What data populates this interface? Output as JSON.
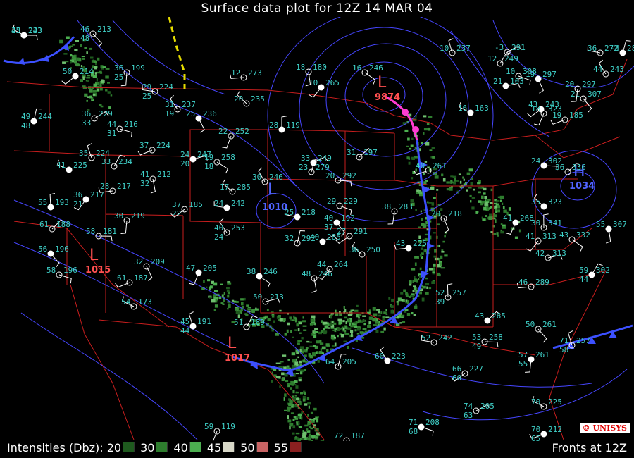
{
  "title": "Surface data plot for 12Z 14 MAR 04",
  "legend": {
    "label": "Intensities (Dbz):",
    "levels": [
      {
        "value": "20",
        "color": "#1e5a1e"
      },
      {
        "value": "30",
        "color": "#2e7d2e"
      },
      {
        "value": "40",
        "color": "#4caf50"
      },
      {
        "value": "45",
        "color": "#d8d8c8"
      },
      {
        "value": "50",
        "color": "#c86464"
      },
      {
        "value": "55",
        "color": "#8a2020"
      }
    ]
  },
  "fronts_label": "Fronts at 12Z",
  "logo": "UNISYS",
  "colors": {
    "isobar": "#4646ff",
    "border": "#c81e1e",
    "station_text": "#3fd0c8",
    "cold_front": "#3c50ff",
    "occluded_front": "#ff3cd2",
    "low": "#ff5050",
    "high": "#5064ff"
  },
  "pressure_centers": [
    {
      "type": "L",
      "value": "9874",
      "color": "#ff5050"
    },
    {
      "type": "L",
      "value": "1010",
      "color": "#5064ff"
    },
    {
      "type": "L",
      "value": "1017",
      "color": "#ff5050"
    },
    {
      "type": "L",
      "value": "1015",
      "color": "#ff5050"
    },
    {
      "type": "H",
      "value": "1034",
      "color": "#5064ff"
    }
  ],
  "stations": [
    {
      "t": "43",
      "d": "",
      "p": "243"
    },
    {
      "t": "46",
      "d": "48",
      "p": "213"
    },
    {
      "t": "36",
      "d": "25",
      "p": "199"
    },
    {
      "t": "50",
      "d": "",
      "p": "214"
    },
    {
      "t": "29",
      "d": "25",
      "p": "224"
    },
    {
      "t": "31",
      "d": "19",
      "p": "237"
    },
    {
      "t": "49",
      "d": "48",
      "p": "244"
    },
    {
      "t": "36",
      "d": "33",
      "p": "229"
    },
    {
      "t": "44",
      "d": "31",
      "p": "216"
    },
    {
      "t": "25",
      "d": "",
      "p": "236"
    },
    {
      "t": "22",
      "d": "",
      "p": "252"
    },
    {
      "t": "37",
      "d": "",
      "p": "224"
    },
    {
      "t": "41",
      "d": "",
      "p": "225"
    },
    {
      "t": "35",
      "d": "",
      "p": "224"
    },
    {
      "t": "33",
      "d": "",
      "p": "234"
    },
    {
      "t": "24",
      "d": "20",
      "p": "247"
    },
    {
      "t": "19",
      "d": "18",
      "p": "258"
    },
    {
      "t": "41",
      "d": "32",
      "p": "212"
    },
    {
      "t": "36",
      "d": "21",
      "p": "217"
    },
    {
      "t": "28",
      "d": "",
      "p": "217"
    },
    {
      "t": "17",
      "d": "",
      "p": "285"
    },
    {
      "t": "55",
      "d": "",
      "p": "193"
    },
    {
      "t": "61",
      "d": "",
      "p": "188"
    },
    {
      "t": "58",
      "d": "",
      "p": "181"
    },
    {
      "t": "56",
      "d": "",
      "p": "196"
    },
    {
      "t": "30",
      "d": "",
      "p": "219"
    },
    {
      "t": "37",
      "d": "22",
      "p": "185"
    },
    {
      "t": "24",
      "d": "",
      "p": "242"
    },
    {
      "t": "40",
      "d": "24",
      "p": "253"
    },
    {
      "t": "32",
      "d": "",
      "p": "292"
    },
    {
      "t": "40",
      "d": "",
      "p": "285"
    },
    {
      "t": "58",
      "d": "",
      "p": "196"
    },
    {
      "t": "32",
      "d": "",
      "p": "209"
    },
    {
      "t": "47",
      "d": "",
      "p": "205"
    },
    {
      "t": "61",
      "d": "",
      "p": "187"
    },
    {
      "t": "54",
      "d": "",
      "p": "173"
    },
    {
      "t": "45",
      "d": "44",
      "p": "191"
    },
    {
      "t": "51",
      "d": "",
      "p": "189"
    },
    {
      "t": "50",
      "d": "",
      "p": "213"
    },
    {
      "t": "38",
      "d": "",
      "p": "246"
    },
    {
      "t": "48",
      "d": "",
      "p": "246"
    },
    {
      "t": "44",
      "d": "",
      "p": "264"
    },
    {
      "t": "43",
      "d": "",
      "p": "225"
    },
    {
      "t": "36",
      "d": "",
      "p": "250"
    },
    {
      "t": "52",
      "d": "39",
      "p": "257"
    },
    {
      "t": "43",
      "d": "",
      "p": "265"
    },
    {
      "t": "53",
      "d": "49",
      "p": "258"
    },
    {
      "t": "50",
      "d": "",
      "p": "261"
    },
    {
      "t": "57",
      "d": "55",
      "p": "261"
    },
    {
      "t": "66",
      "d": "60",
      "p": "227"
    },
    {
      "t": "52",
      "d": "",
      "p": "242"
    },
    {
      "t": "60",
      "d": "",
      "p": "223"
    },
    {
      "t": "64",
      "d": "",
      "p": "205"
    },
    {
      "t": "74",
      "d": "63",
      "p": "205"
    },
    {
      "t": "71",
      "d": "68",
      "p": "208"
    },
    {
      "t": "72",
      "d": "",
      "p": "187"
    },
    {
      "t": "59",
      "d": "",
      "p": "119"
    },
    {
      "t": "70",
      "d": "65",
      "p": "212"
    },
    {
      "t": "70",
      "d": "",
      "p": "225"
    },
    {
      "t": "71",
      "d": "58",
      "p": "257"
    },
    {
      "t": "59",
      "d": "44",
      "p": "302"
    },
    {
      "t": "42",
      "d": "",
      "p": "313"
    },
    {
      "t": "43",
      "d": "",
      "p": "332"
    },
    {
      "t": "55",
      "d": "",
      "p": "307"
    },
    {
      "t": "41",
      "d": "",
      "p": "313"
    },
    {
      "t": "46",
      "d": "",
      "p": "289"
    },
    {
      "t": "35",
      "d": "",
      "p": "323"
    },
    {
      "t": "30",
      "d": "",
      "p": "341"
    },
    {
      "t": "36",
      "d": "",
      "p": "336"
    },
    {
      "t": "24",
      "d": "",
      "p": "302"
    },
    {
      "t": "21",
      "d": "",
      "p": "307"
    },
    {
      "t": "20",
      "d": "",
      "p": "297"
    },
    {
      "t": "43",
      "d": "",
      "p": "243"
    },
    {
      "t": "36",
      "d": "",
      "p": "272"
    },
    {
      "t": "44",
      "d": "",
      "p": "243"
    },
    {
      "t": "-4",
      "d": "",
      "p": "284"
    },
    {
      "t": "-3",
      "d": "",
      "p": "291"
    },
    {
      "t": "10",
      "d": "",
      "p": "308"
    },
    {
      "t": "19",
      "d": "",
      "p": "297"
    },
    {
      "t": "18",
      "d": "",
      "p": "323"
    },
    {
      "t": "19",
      "d": "",
      "p": "185"
    },
    {
      "t": "16",
      "d": "",
      "p": "163"
    },
    {
      "t": "10",
      "d": "",
      "p": "237"
    },
    {
      "t": "12",
      "d": "",
      "p": "249"
    },
    {
      "t": "21",
      "d": "",
      "p": "103"
    },
    {
      "t": "16",
      "d": "",
      "p": "246"
    },
    {
      "t": "18",
      "d": "",
      "p": "180"
    },
    {
      "t": "10",
      "d": "",
      "p": "265"
    },
    {
      "t": "12",
      "d": "",
      "p": "273"
    },
    {
      "t": "20",
      "d": "",
      "p": "235"
    },
    {
      "t": "28",
      "d": "",
      "p": "119"
    },
    {
      "t": "31",
      "d": "",
      "p": "197"
    },
    {
      "t": "20",
      "d": "",
      "p": "292"
    },
    {
      "t": "40",
      "d": "37",
      "p": "192"
    },
    {
      "t": "38",
      "d": "",
      "p": "283"
    },
    {
      "t": "27",
      "d": "",
      "p": "291"
    },
    {
      "t": "25",
      "d": "",
      "p": "218"
    },
    {
      "t": "30",
      "d": "",
      "p": "246"
    },
    {
      "t": "23",
      "d": "",
      "p": "279"
    },
    {
      "t": "33",
      "d": "",
      "p": "249"
    },
    {
      "t": "29",
      "d": "",
      "p": "229"
    },
    {
      "t": "20",
      "d": "",
      "p": "218"
    },
    {
      "t": "41",
      "d": "",
      "p": "268"
    },
    {
      "t": "40",
      "d": "",
      "p": "261"
    },
    {
      "t": "35",
      "d": "",
      "p": "233"
    }
  ]
}
